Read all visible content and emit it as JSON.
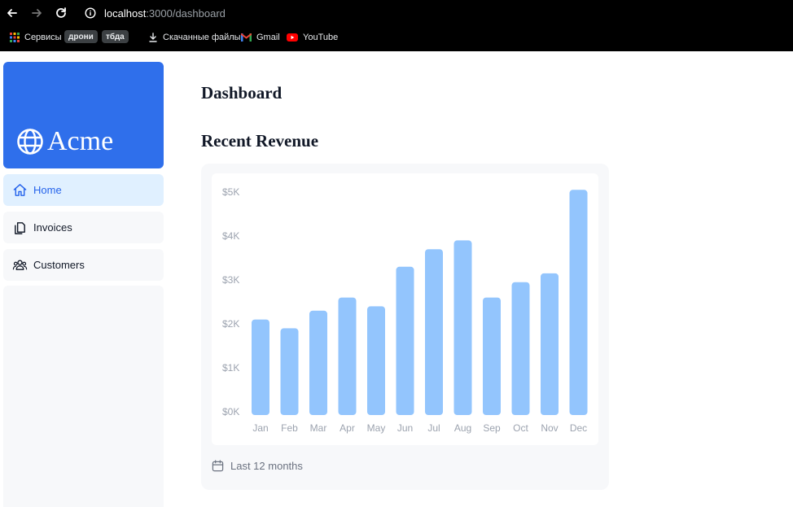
{
  "browser": {
    "url_host": "localhost",
    "url_path": ":3000/dashboard",
    "bookmarks": {
      "apps": "Сервисы",
      "chip1": "дрони",
      "chip2": "тбда",
      "downloads": "Скачанные файлы",
      "gmail": "Gmail",
      "youtube": "YouTube"
    }
  },
  "sidebar": {
    "logo_text": "Acme",
    "items": [
      {
        "label": "Home",
        "icon": "home-icon"
      },
      {
        "label": "Invoices",
        "icon": "documents-icon"
      },
      {
        "label": "Customers",
        "icon": "users-icon"
      }
    ]
  },
  "main": {
    "title": "Dashboard",
    "section_title": "Recent Revenue",
    "footer_label": "Last 12 months"
  },
  "colors": {
    "accent": "#2f6feb",
    "bar": "#93c5fd",
    "active_bg": "#e0f0ff",
    "active_text": "#2563eb"
  },
  "chart_data": {
    "type": "bar",
    "categories": [
      "Jan",
      "Feb",
      "Mar",
      "Apr",
      "May",
      "Jun",
      "Jul",
      "Aug",
      "Sep",
      "Oct",
      "Nov",
      "Dec"
    ],
    "values": [
      2100,
      1900,
      2300,
      2600,
      2400,
      3300,
      3700,
      3900,
      2600,
      2950,
      3150,
      5050
    ],
    "ylim": [
      0,
      5000
    ],
    "yticks": [
      0,
      1000,
      2000,
      3000,
      4000,
      5000
    ],
    "ytick_labels": [
      "$0K",
      "$1K",
      "$2K",
      "$3K",
      "$4K",
      "$5K"
    ],
    "grid": false
  }
}
